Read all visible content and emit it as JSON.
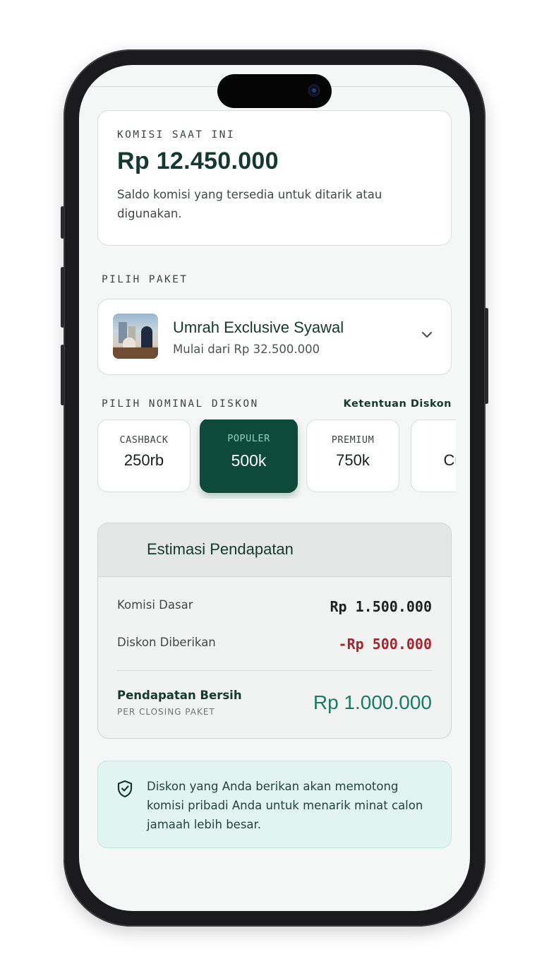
{
  "komisi": {
    "label": "KOMISI SAAT INI",
    "amount": "Rp 12.450.000",
    "description": "Saldo komisi yang tersedia untuk ditarik atau digunakan."
  },
  "paket": {
    "section_label": "PILIH PAKET",
    "name": "Umrah Exclusive Syawal",
    "price": "Mulai dari Rp 32.500.000"
  },
  "diskon": {
    "section_label": "PILIH NOMINAL DISKON",
    "terms_link": "Ketentuan Diskon",
    "options": [
      {
        "tag": "CASHBACK",
        "value": "250rb",
        "selected": false
      },
      {
        "tag": "POPULER",
        "value": "500k",
        "selected": true
      },
      {
        "tag": "PREMIUM",
        "value": "750k",
        "selected": false
      },
      {
        "tag": "",
        "value": "Cus",
        "selected": false
      }
    ]
  },
  "estimasi": {
    "title": "Estimasi Pendapatan",
    "rows": [
      {
        "label": "Komisi Dasar",
        "value": "Rp 1.500.000"
      },
      {
        "label": "Diskon Diberikan",
        "value": "-Rp 500.000"
      }
    ],
    "net_label": "Pendapatan Bersih",
    "net_sublabel": "PER CLOSING PAKET",
    "net_value": "Rp 1.000.000"
  },
  "info": {
    "icon": "shield-check-icon",
    "text": "Diskon yang Anda berikan akan memotong komisi pribadi Anda untuk menarik minat calon jamaah lebih besar."
  },
  "colors": {
    "primary": "#0d4a3b",
    "accent_text": "#1a7a62",
    "negative": "#a8252b",
    "info_bg": "#e1f4ef"
  }
}
